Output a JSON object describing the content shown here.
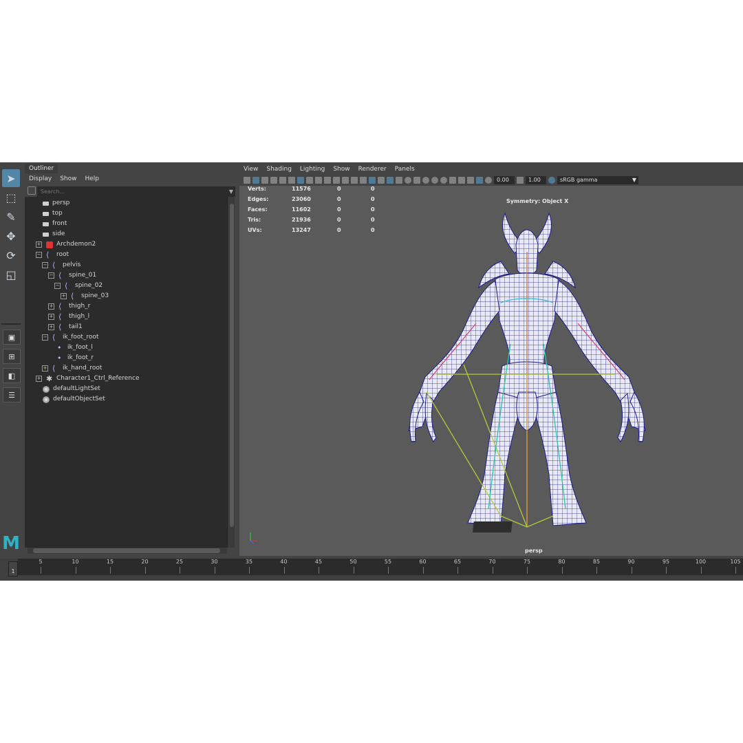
{
  "outliner": {
    "tab": "Outliner",
    "menu": [
      "Display",
      "Show",
      "Help"
    ],
    "search_placeholder": "Search...",
    "items": [
      {
        "label": "persp",
        "icon": "camera-icon"
      },
      {
        "label": "top",
        "icon": "camera-icon"
      },
      {
        "label": "front",
        "icon": "camera-icon"
      },
      {
        "label": "side",
        "icon": "camera-icon"
      },
      {
        "label": "Archdemon2",
        "icon": "mesh-icon"
      },
      {
        "label": "root",
        "icon": "joint-icon"
      },
      {
        "label": "pelvis",
        "icon": "joint-icon"
      },
      {
        "label": "spine_01",
        "icon": "joint-icon"
      },
      {
        "label": "spine_02",
        "icon": "joint-icon"
      },
      {
        "label": "spine_03",
        "icon": "joint-icon"
      },
      {
        "label": "thigh_r",
        "icon": "joint-icon"
      },
      {
        "label": "thigh_l",
        "icon": "joint-icon"
      },
      {
        "label": "tail1",
        "icon": "joint-icon"
      },
      {
        "label": "ik_foot_root",
        "icon": "joint-icon"
      },
      {
        "label": "ik_foot_l",
        "icon": "joint-icon"
      },
      {
        "label": "ik_foot_r",
        "icon": "joint-icon"
      },
      {
        "label": "ik_hand_root",
        "icon": "joint-icon"
      },
      {
        "label": "Character1_Ctrl_Reference",
        "icon": "reference-icon"
      },
      {
        "label": "defaultLightSet",
        "icon": "set-icon"
      },
      {
        "label": "defaultObjectSet",
        "icon": "set-icon"
      }
    ]
  },
  "viewport": {
    "menu": [
      "View",
      "Shading",
      "Lighting",
      "Show",
      "Renderer",
      "Panels"
    ],
    "exposure": "0.00",
    "gamma": "1.00",
    "color_space": "sRGB gamma",
    "symmetry": "Symmetry: Object X",
    "camera": "persp",
    "stats": [
      {
        "label": "Verts:",
        "values": [
          "11576",
          "0",
          "0"
        ]
      },
      {
        "label": "Edges:",
        "values": [
          "23060",
          "0",
          "0"
        ]
      },
      {
        "label": "Faces:",
        "values": [
          "11602",
          "0",
          "0"
        ]
      },
      {
        "label": "Tris:",
        "values": [
          "21936",
          "0",
          "0"
        ]
      },
      {
        "label": "UVs:",
        "values": [
          "13247",
          "0",
          "0"
        ]
      }
    ]
  },
  "timeline": {
    "current_frame": "1",
    "ticks": [
      "5",
      "10",
      "15",
      "20",
      "25",
      "30",
      "35",
      "40",
      "45",
      "50",
      "55",
      "60",
      "65",
      "70",
      "75",
      "80",
      "85",
      "90",
      "95",
      "100",
      "105"
    ]
  },
  "colors": {
    "accent": "#5285a6",
    "mesh_wire": "#1a1a8c",
    "skeleton": "#b5c93a",
    "logo": "#2fb3c4"
  }
}
